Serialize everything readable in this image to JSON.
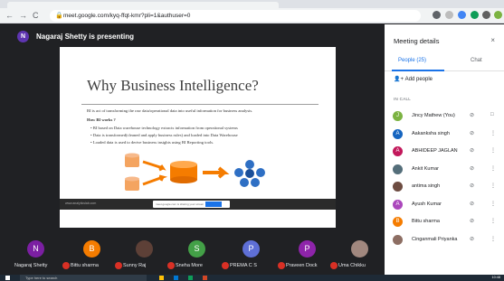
{
  "browser": {
    "url": "meet.google.com/kyq-ffqt-kmr?pli=1&authuser=0",
    "nav_back": "←",
    "nav_forward": "→",
    "nav_reload": "C"
  },
  "presenter": {
    "initial": "N",
    "text": "Nagaraj Shetty is presenting"
  },
  "slide": {
    "title": "Why Business Intelligence?",
    "intro": "BI is act of transforming the raw data/operational data into useful information for business analysis.",
    "subhead": "How BI works ?",
    "bullets": [
      "BI based on Data warehouse technology extracts information from operational systems",
      "Data is transformed(cleaned and apply business rules) and loaded into Data Warehouse",
      "Loaded data is used to derive business insights using BI Reporting tools."
    ],
    "footer_left": "www.analyticslab.com",
    "control_text": "meet.google.com is sharing your screen",
    "stop_label": "Stop sharing",
    "hide_label": "Hide"
  },
  "participants": [
    {
      "initial": "N",
      "name": "Nagaraj Shetty",
      "color": "#7b1fa2",
      "has_photo": false
    },
    {
      "initial": "B",
      "name": "Bittu sharma",
      "color": "#f57c00",
      "has_photo": false
    },
    {
      "initial": "",
      "name": "Sunny Raj",
      "color": "#5d4037",
      "has_photo": true
    },
    {
      "initial": "S",
      "name": "Sneha More",
      "color": "#43a047",
      "has_photo": false
    },
    {
      "initial": "P",
      "name": "PREMA C S",
      "color": "#5e6fd6",
      "has_photo": false
    },
    {
      "initial": "P",
      "name": "Praveen Dock",
      "color": "#8e24aa",
      "has_photo": false
    },
    {
      "initial": "",
      "name": "Uma Chikku",
      "color": "#a1887f",
      "has_photo": true
    }
  ],
  "panel": {
    "title": "Meeting details",
    "close": "×",
    "people_tab": "People (25)",
    "chat_tab": "Chat",
    "add_people": "Add people",
    "in_call": "IN CALL",
    "list": [
      {
        "initial": "J",
        "name": "Jincy Mathew (You)",
        "color": "#7cb342"
      },
      {
        "initial": "A",
        "name": "Aakanksha singh",
        "color": "#1565c0"
      },
      {
        "initial": "A",
        "name": "ABHIDEEP JAGLAN",
        "color": "#c2185b"
      },
      {
        "initial": "",
        "name": "Ankit Kumar",
        "color": "#546e7a"
      },
      {
        "initial": "",
        "name": "antima singh",
        "color": "#6d4c41"
      },
      {
        "initial": "A",
        "name": "Ayush Kumar",
        "color": "#ab47bc"
      },
      {
        "initial": "B",
        "name": "Bittu sharma",
        "color": "#f57c00"
      },
      {
        "initial": "",
        "name": "Cinganmali Priyanka",
        "color": "#8d6e63"
      }
    ]
  },
  "taskbar": {
    "search_placeholder": "Type here to search",
    "time": "10:48"
  },
  "colors": {
    "accent": "#1a73e8",
    "meeting_bg": "#202124",
    "mute_red": "#d93025"
  }
}
